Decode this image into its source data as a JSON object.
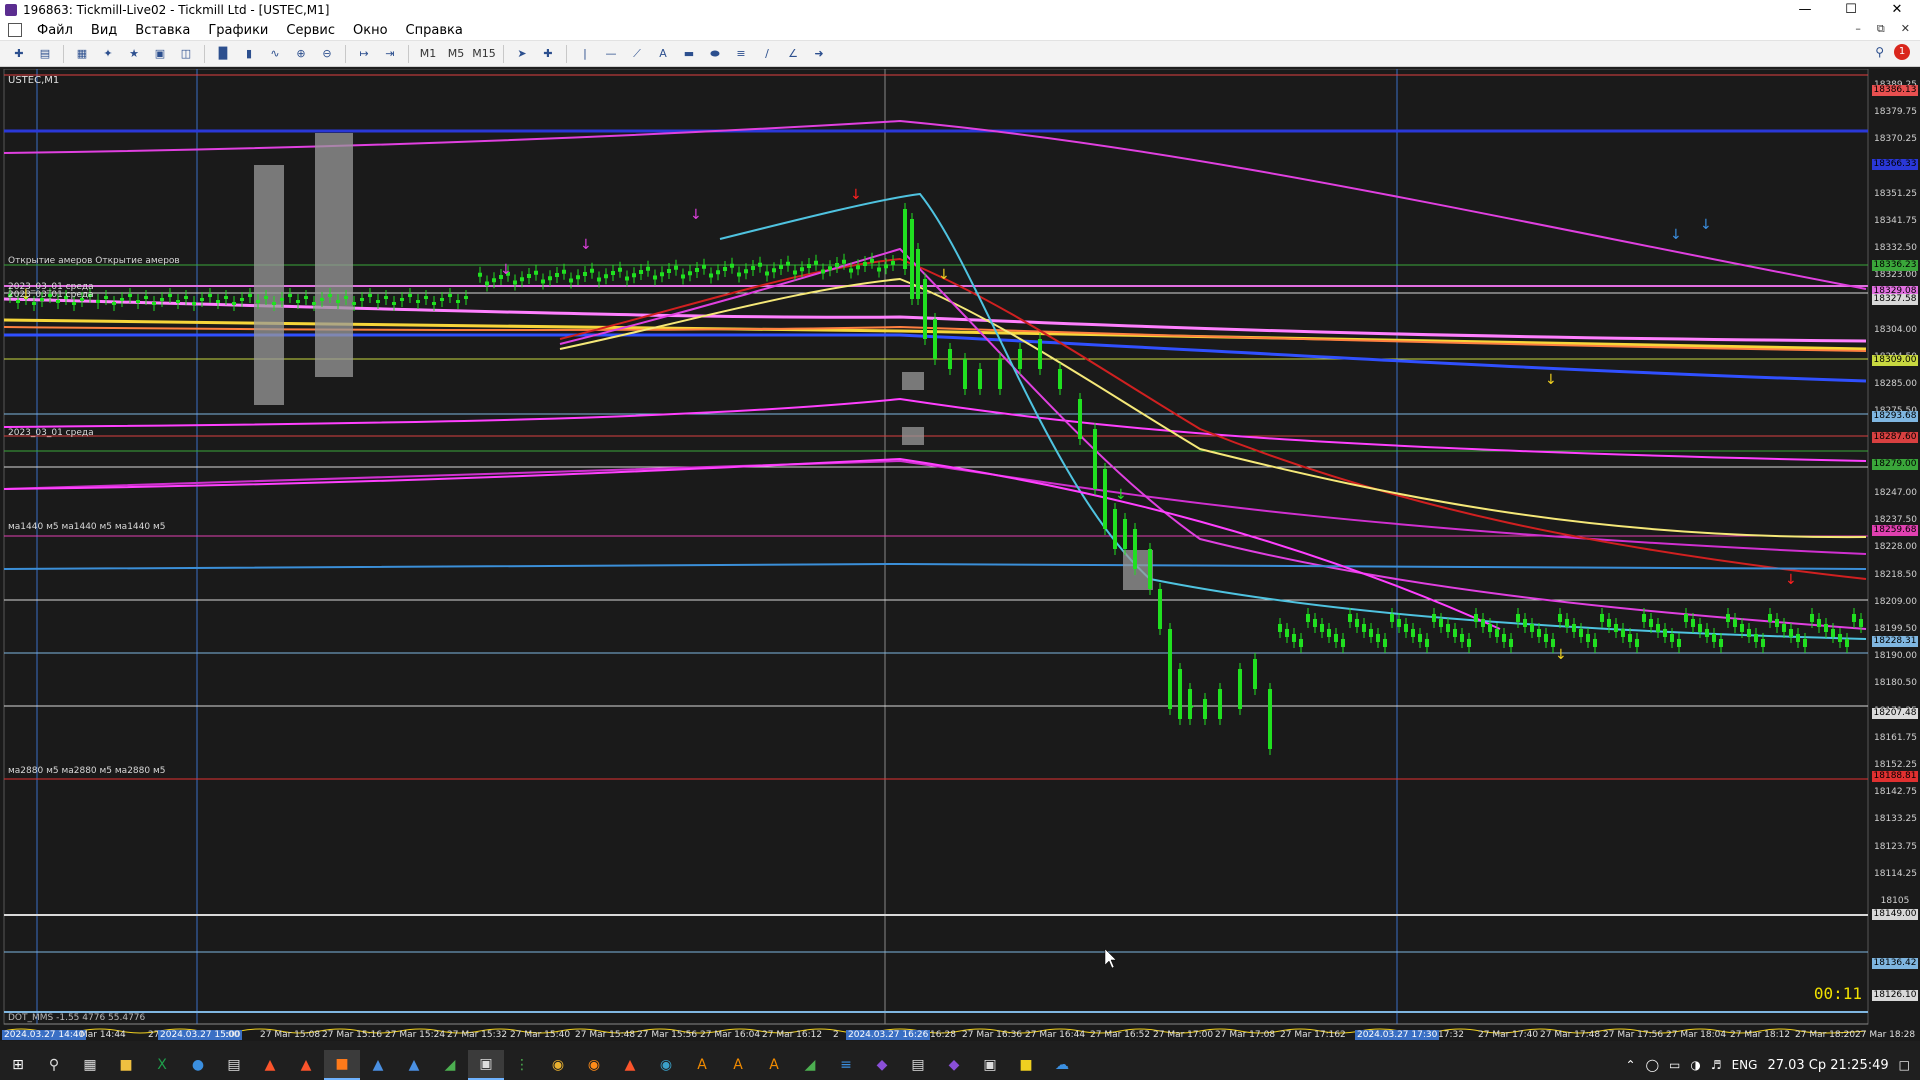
{
  "window": {
    "title": "196863: Tickmill-Live02 - Tickmill Ltd - [USTEC,M1]",
    "min_icon": "minimize-icon",
    "max_icon": "maximize-icon",
    "close_icon": "close-icon"
  },
  "menu": {
    "items": [
      "Файл",
      "Вид",
      "Вставка",
      "Графики",
      "Сервис",
      "Окно",
      "Справка"
    ]
  },
  "toolbar": {
    "timeframes": [
      "M1",
      "M5",
      "M15"
    ]
  },
  "chart": {
    "symbol_label": "USTEC,M1",
    "level_labels": [
      "Открытие амеров   Открытие амеров",
      "2023_03_01 среда",
      "2023_03_01 среда",
      "2023_03_01 среда",
      "ма1440 м5 ма1440 м5 ма1440 м5",
      "ма2880 м5 ма2880 м5 ма2880 м5"
    ],
    "indicator_label": "DOT_MMS -1.55 4776 55.4776",
    "timer": "00:11",
    "price_scale": [
      "18389.25",
      "18379.75",
      "18370.25",
      "18360.75",
      "18351.25",
      "18341.75",
      "18332.50",
      "18323.00",
      "18313.50",
      "18304.00",
      "18294.50",
      "18285.00",
      "18275.50",
      "18266.00",
      "18256.50",
      "18247.00",
      "18237.50",
      "18228.00",
      "18218.50",
      "18209.00",
      "18199.50",
      "18190.00",
      "18180.50",
      "18171.25",
      "18161.75",
      "18152.25",
      "18142.75",
      "18133.25",
      "18123.75",
      "18114.25",
      "18105"
    ],
    "price_tags": [
      {
        "text": "18386.13",
        "color": "#e85050"
      },
      {
        "text": "18366.33",
        "color": "#2a38d8"
      },
      {
        "text": "18336.23",
        "color": "#3aa63a"
      },
      {
        "text": "18329.08",
        "color": "#e070e0"
      },
      {
        "text": "18327.58",
        "color": "#d8d8d8"
      },
      {
        "text": "18309.00",
        "color": "#c8d840"
      },
      {
        "text": "18293.68",
        "color": "#7fb6e0"
      },
      {
        "text": "18287.60",
        "color": "#d84040"
      },
      {
        "text": "18279.00",
        "color": "#3aa63a"
      },
      {
        "text": "18259.68",
        "color": "#e040b0"
      },
      {
        "text": "18228.31",
        "color": "#7fb6e0"
      },
      {
        "text": "18207.48",
        "color": "#dcdcdc"
      },
      {
        "text": "18188.81",
        "color": "#e03030"
      },
      {
        "text": "18149.00",
        "color": "#d8d8d8"
      },
      {
        "text": "18136.42",
        "color": "#7fb6e0"
      },
      {
        "text": "18126.10",
        "color": "#d8d8d8"
      }
    ],
    "time_labels": [
      "2024.03.27 14:40",
      "Mar 14:44",
      "27 Ma",
      "2024.03.27 15:00",
      ":00",
      "27 Mar 15:08",
      "27 Mar 15:16",
      "27 Mar 15:24",
      "27 Mar 15:32",
      "27 Mar 15:40",
      "27 Mar 15:48",
      "27 Mar 15:56",
      "27 Mar 16:04",
      "27 Mar 16:12",
      "2",
      "2024.03.27 16:26",
      "16:28",
      "27 Mar 16:36",
      "27 Mar 16:44",
      "27 Mar 16:52",
      "27 Mar 17:00",
      "27 Mar 17:08",
      "27 Mar 17:16",
      "2",
      "2024.03.27 17:30",
      "17:32",
      "27 Mar 17:40",
      "27 Mar 17:48",
      "27 Mar 17:56",
      "27 Mar 18:04",
      "27 Mar 18:12",
      "27 Mar 18:20",
      "27 Mar 18:28"
    ]
  },
  "taskbar": {
    "lang": "ENG",
    "clock": "27.03 Ср 21:25:49"
  }
}
